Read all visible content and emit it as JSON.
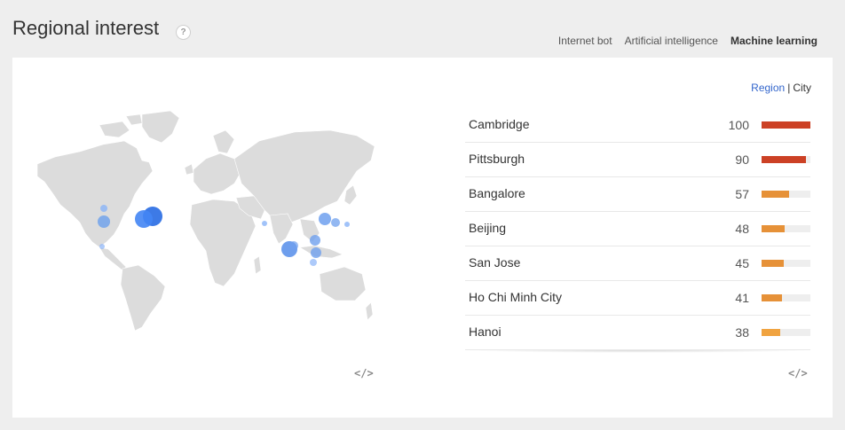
{
  "header": {
    "title": "Regional interest",
    "help": "?"
  },
  "tabs": [
    {
      "label": "Internet bot",
      "active": false
    },
    {
      "label": "Artificial intelligence",
      "active": false
    },
    {
      "label": "Machine learning",
      "active": true
    }
  ],
  "toggle": {
    "region": "Region",
    "separator": "|",
    "city": "City"
  },
  "embed_icon": "</>",
  "colors": {
    "accent_tab": "#f0b72c",
    "bubble": "#4a86e8",
    "bar_high": "#cc4125",
    "bar_mid": "#e69138"
  },
  "rows": [
    {
      "name": "Cambridge",
      "value": 100,
      "level": 1.0,
      "color": "#cc4125"
    },
    {
      "name": "Pittsburgh",
      "value": 90,
      "level": 0.9,
      "color": "#cc4125"
    },
    {
      "name": "Bangalore",
      "value": 57,
      "level": 0.57,
      "color": "#e69138"
    },
    {
      "name": "Beijing",
      "value": 48,
      "level": 0.48,
      "color": "#e69138"
    },
    {
      "name": "San Jose",
      "value": 45,
      "level": 0.45,
      "color": "#e69138"
    },
    {
      "name": "Ho Chi Minh City",
      "value": 41,
      "level": 0.41,
      "color": "#e69138"
    },
    {
      "name": "Hanoi",
      "value": 38,
      "level": 0.38,
      "color": "#f0a340"
    }
  ]
}
